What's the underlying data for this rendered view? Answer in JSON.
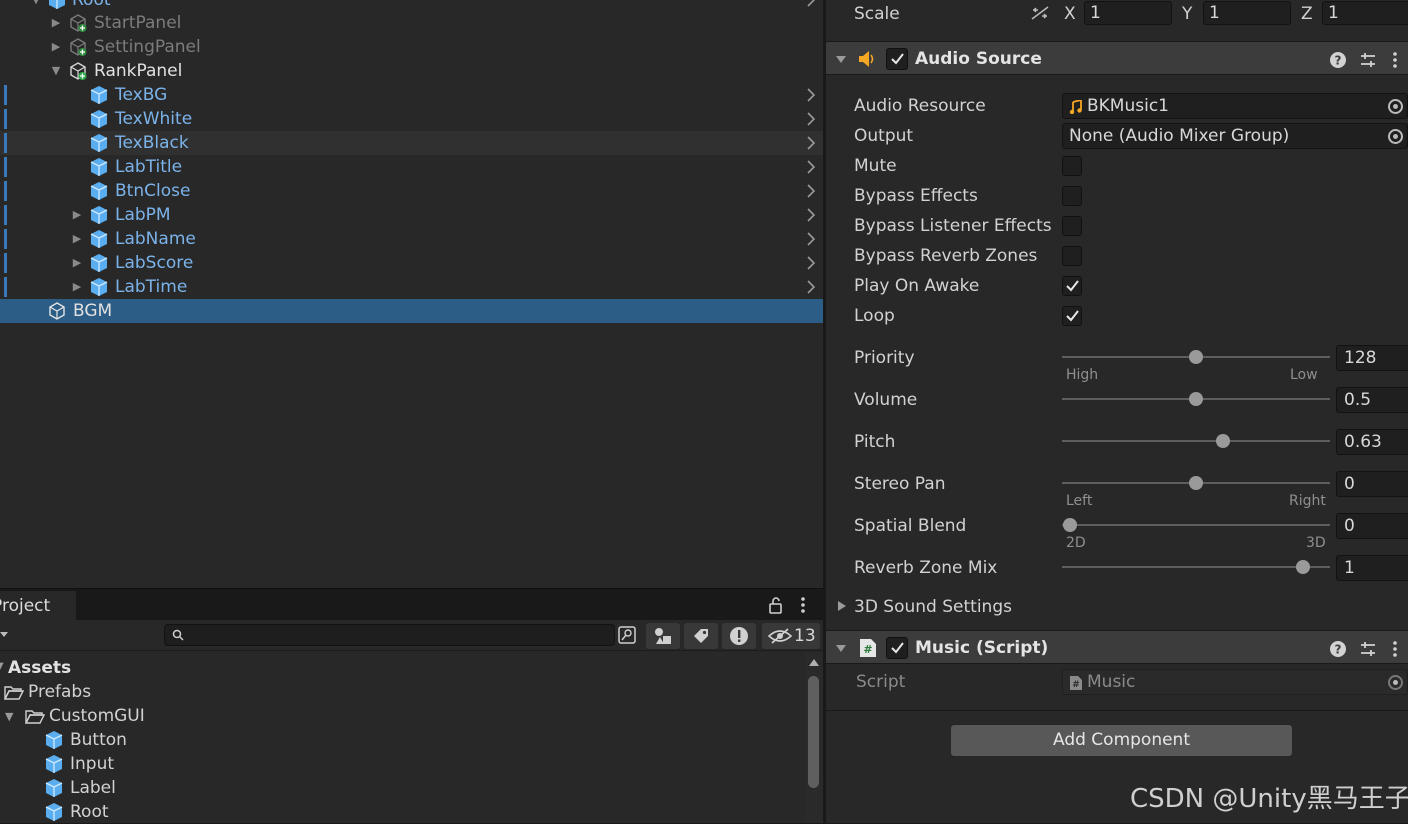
{
  "hierarchy": {
    "rows": [
      {
        "label": "Root",
        "style": "blue"
      },
      {
        "label": "StartPanel",
        "style": "dim"
      },
      {
        "label": "SettingPanel",
        "style": "dim"
      },
      {
        "label": "RankPanel",
        "style": "white"
      },
      {
        "label": "TexBG",
        "style": "blue"
      },
      {
        "label": "TexWhite",
        "style": "blue"
      },
      {
        "label": "TexBlack",
        "style": "blue"
      },
      {
        "label": "LabTitle",
        "style": "blue"
      },
      {
        "label": "BtnClose",
        "style": "blue"
      },
      {
        "label": "LabPM",
        "style": "blue"
      },
      {
        "label": "LabName",
        "style": "blue"
      },
      {
        "label": "LabScore",
        "style": "blue"
      },
      {
        "label": "LabTime",
        "style": "blue"
      },
      {
        "label": "BGM",
        "style": "selected"
      }
    ]
  },
  "project": {
    "tab_label": "Project",
    "hidden_count": "13",
    "tree": [
      {
        "label": "Assets"
      },
      {
        "label": "Prefabs"
      },
      {
        "label": "CustomGUI"
      },
      {
        "label": "Button"
      },
      {
        "label": "Input"
      },
      {
        "label": "Label"
      },
      {
        "label": "Root"
      }
    ]
  },
  "inspector": {
    "scale": {
      "label": "Scale",
      "x_label": "X",
      "x": "1",
      "y_label": "Y",
      "y": "1",
      "z_label": "Z",
      "z": "1"
    },
    "audio_source": {
      "title": "Audio Source",
      "enabled": true,
      "audio_resource": {
        "label": "Audio Resource",
        "value": "BKMusic1"
      },
      "output": {
        "label": "Output",
        "value": "None (Audio Mixer Group)"
      },
      "toggles": [
        {
          "label": "Mute",
          "checked": false
        },
        {
          "label": "Bypass Effects",
          "checked": false
        },
        {
          "label": "Bypass Listener Effects",
          "checked": false
        },
        {
          "label": "Bypass Reverb Zones",
          "checked": false
        },
        {
          "label": "Play On Awake",
          "checked": true
        },
        {
          "label": "Loop",
          "checked": true
        }
      ],
      "sliders": [
        {
          "label": "Priority",
          "value": "128",
          "fraction": 0.5,
          "min_hint": "High",
          "max_hint": "Low"
        },
        {
          "label": "Volume",
          "value": "0.5",
          "fraction": 0.5,
          "min_hint": "",
          "max_hint": ""
        },
        {
          "label": "Pitch",
          "value": "0.63",
          "fraction": 0.6,
          "min_hint": "",
          "max_hint": ""
        },
        {
          "label": "Stereo Pan",
          "value": "0",
          "fraction": 0.5,
          "min_hint": "Left",
          "max_hint": "Right"
        },
        {
          "label": "Spatial Blend",
          "value": "0",
          "fraction": 0.03,
          "min_hint": "2D",
          "max_hint": "3D"
        },
        {
          "label": "Reverb Zone Mix",
          "value": "1",
          "fraction": 0.9,
          "min_hint": "",
          "max_hint": ""
        }
      ],
      "foldout_3d": "3D Sound Settings"
    },
    "music_script": {
      "title": "Music (Script)",
      "enabled": true,
      "script_label": "Script",
      "script_value": "Music"
    },
    "add_component": "Add Component"
  },
  "watermark": "CSDN @Unity黑马王子",
  "colors": {
    "selection": "#2c5d87",
    "prefab_blue": "#7bb3ea",
    "audio_icon": "#f5a623"
  }
}
